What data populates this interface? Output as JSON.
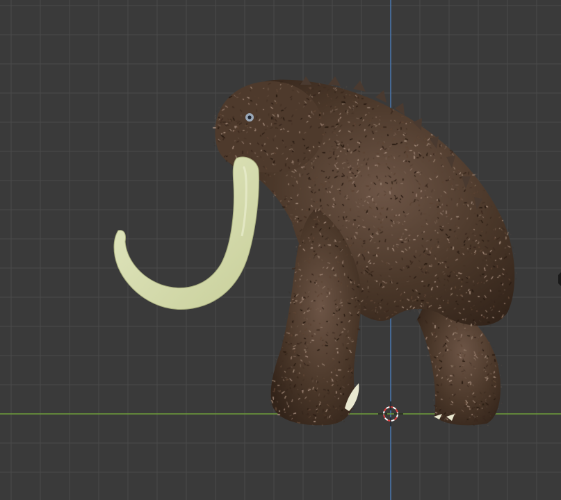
{
  "viewport": {
    "name": "3D Viewport",
    "background": "#3a3a3a",
    "grid_color": "#4a4a4a",
    "grid_major_color": "#505050",
    "x_axis_color": "#6e9e3a",
    "y_axis_color": "#4a78b0"
  },
  "scene": {
    "object": "mammoth-model",
    "fur_color_dark": "#3b2a20",
    "fur_color_mid": "#5e4636",
    "fur_color_light": "#8c7565",
    "tusk_color": "#d9deb2",
    "tusk_shadow": "#b9c08a",
    "claw_color": "#e8e6cf"
  },
  "cursor": {
    "name": "3d-cursor",
    "ring_color_a": "#e04040",
    "ring_color_b": "#ffffff"
  },
  "gizmo": {
    "name": "navigation-gizmo-edge",
    "color": "#1a1a1a"
  }
}
